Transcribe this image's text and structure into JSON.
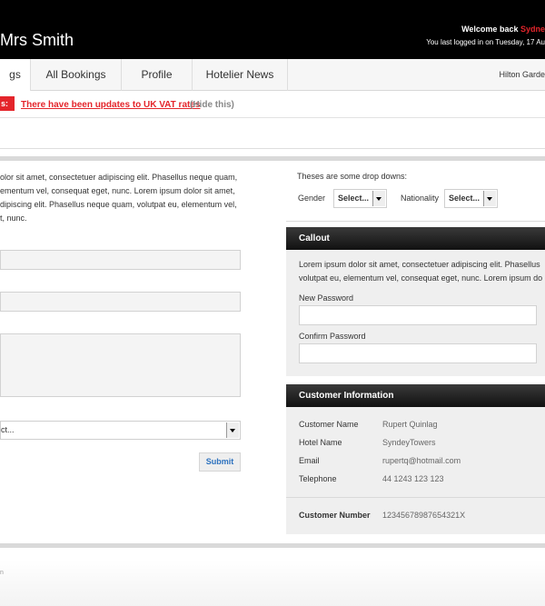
{
  "header": {
    "user_name": "Mrs Smith",
    "welcome_prefix": "Welcome back",
    "welcome_name": "Sydne",
    "last_login": "You last logged in on Tuesday, 17 Au"
  },
  "nav": {
    "tabs": [
      {
        "label": "gs",
        "active": true
      },
      {
        "label": "All Bookings",
        "active": false
      },
      {
        "label": "Profile",
        "active": false
      },
      {
        "label": "Hotelier News",
        "active": false
      }
    ],
    "hotel": "Hilton Garde"
  },
  "alert": {
    "badge": "s:",
    "message": "There have been updates to UK VAT rates",
    "hide": "(Hide this)"
  },
  "left": {
    "intro_lines": [
      "olor sit amet, consectetuer adipiscing elit. Phasellus neque quam,",
      "ementum vel, consequat eget, nunc. Lorem ipsum dolor sit amet,",
      "dipiscing elit. Phasellus neque quam, volutpat eu, elementum vel,",
      "t, nunc."
    ],
    "select_value": "ct...",
    "submit_label": "Submit"
  },
  "dropdowns": {
    "title": "Theses are some drop downs:",
    "gender_label": "Gender",
    "gender_value": "Select...",
    "nationality_label": "Nationality",
    "nationality_value": "Select..."
  },
  "callout": {
    "title": "Callout",
    "body_lines": [
      "Lorem ipsum dolor sit amet, consectetuer adipiscing elit. Phasellus",
      "volutpat eu, elementum vel, consequat eget, nunc. Lorem ipsum do"
    ],
    "new_password_label": "New Password",
    "confirm_password_label": "Confirm Password"
  },
  "customer": {
    "title": "Customer Information",
    "rows": [
      {
        "key": "Customer Name",
        "value": "Rupert Quinlag"
      },
      {
        "key": "Hotel Name",
        "value": "SyndeyTowers"
      },
      {
        "key": "Email",
        "value": "rupertq@hotmail.com"
      },
      {
        "key": "Telephone",
        "value": "44 1243 123 123"
      }
    ],
    "number_label": "Customer Number",
    "number_value": "12345678987654321X"
  },
  "footer": {
    "mark": "n"
  }
}
